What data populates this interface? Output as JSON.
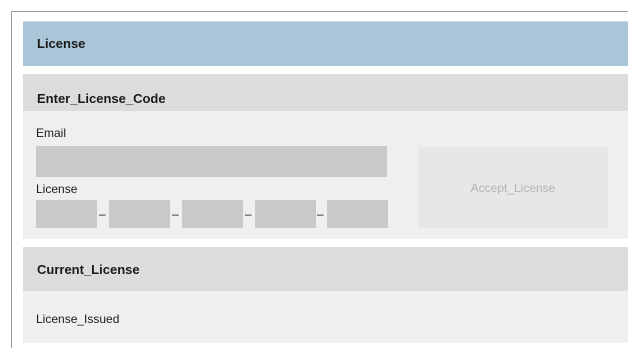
{
  "header": {
    "title": "License"
  },
  "enter_license": {
    "title": "Enter_License_Code",
    "email_label": "Email",
    "email_value": "",
    "license_label": "License",
    "license_segments": [
      "",
      "",
      "",
      "",
      ""
    ],
    "segment_separator": "–",
    "accept_button_label": "Accept_License"
  },
  "current_license": {
    "title": "Current_License",
    "issued_label": "License_Issued"
  },
  "colors": {
    "header_bar": "#a9c6d8",
    "panel_head": "#dcdcdc",
    "panel_body": "#efefef",
    "input_fill": "#c9c9c9",
    "button_disabled_text": "#b3b3b3"
  }
}
